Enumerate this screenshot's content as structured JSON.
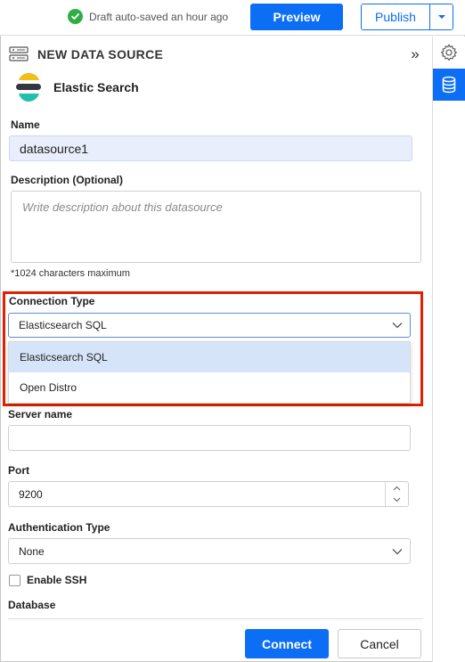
{
  "topbar": {
    "saved_status": "Draft auto-saved an hour ago",
    "preview_label": "Preview",
    "publish_label": "Publish"
  },
  "rail": {
    "items": [
      {
        "icon": "gear-icon",
        "active": false
      },
      {
        "icon": "database-icon",
        "active": true
      }
    ]
  },
  "panel": {
    "title": "NEW DATA SOURCE",
    "collapse_glyph": "»",
    "datasource_type": "Elastic Search",
    "name_label": "Name",
    "name_value": "datasource1",
    "description_label": "Description (Optional)",
    "description_placeholder": "Write description about this datasource",
    "description_hint": "*1024 characters maximum",
    "connection_type_label": "Connection Type",
    "connection_type_value": "Elasticsearch SQL",
    "connection_type_options": [
      "Elasticsearch SQL",
      "Open Distro"
    ],
    "server_name_label": "Server name",
    "server_name_value": "",
    "port_label": "Port",
    "port_value": "9200",
    "auth_type_label": "Authentication Type",
    "auth_type_value": "None",
    "enable_ssh_label": "Enable SSH",
    "database_label": "Database",
    "connect_label": "Connect",
    "cancel_label": "Cancel"
  },
  "colors": {
    "primary": "#0b6ef5",
    "highlight": "#e02000",
    "success": "#2fae46",
    "filled_input": "#e8eefb",
    "selected_option": "#d6e4fa"
  }
}
